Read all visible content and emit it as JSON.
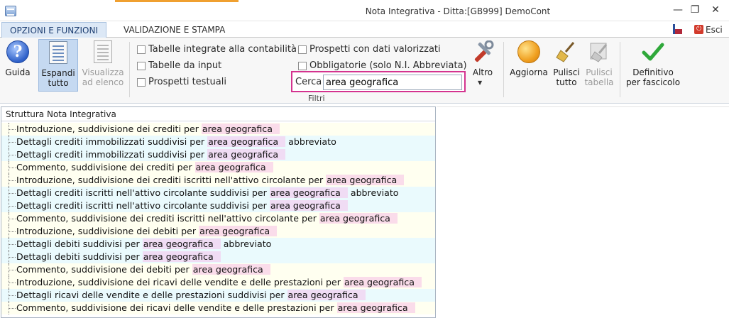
{
  "window": {
    "title": "Nota Integrativa - Ditta:[GB999] DemoCont",
    "minimize": "—",
    "maximize": "❐",
    "close": "✕"
  },
  "tabs": [
    {
      "label": "OPZIONI E FUNZIONI",
      "active": true
    },
    {
      "label": "VALIDAZIONE E STAMPA",
      "active": false
    }
  ],
  "topright": {
    "exit_label": "Esci",
    "exit_icon": "⏻"
  },
  "ribbon": {
    "guida": "Guida",
    "guida_icon": "?",
    "espandi_1": "Espandi",
    "espandi_2": "tutto",
    "visualizza_1": "Visualizza",
    "visualizza_2": "ad elenco",
    "checkboxes": {
      "tabelle_integrate": "Tabelle integrate alla contabilità",
      "tabelle_input": "Tabelle da input",
      "prospetti_testuali": "Prospetti testuali",
      "prospetti_valorizzati": "Prospetti con dati valorizzati",
      "obbligatorie": "Obbligatorie (solo N.I. Abbreviata)"
    },
    "search_label": "Cerca",
    "search_value": "area geografica",
    "filtri": "Filtri",
    "altro": "Altro",
    "aggiorna": "Aggiorna",
    "pulisci_tutto_1": "Pulisci",
    "pulisci_tutto_2": "tutto",
    "pulisci_tabella_1": "Pulisci",
    "pulisci_tabella_2": "tabella",
    "definitivo_1": "Definitivo",
    "definitivo_2": "per fascicolo"
  },
  "tree": {
    "header": "Struttura Nota Integrativa",
    "highlight": "area geografica",
    "rows": [
      {
        "pre": "Introduzione, suddivisione dei crediti per ",
        "post": ""
      },
      {
        "pre": "Dettagli crediti immobilizzati suddivisi per ",
        "post": " abbreviato"
      },
      {
        "pre": "Dettagli crediti immobilizzati suddivisi per ",
        "post": ""
      },
      {
        "pre": "Commento, suddivisione dei crediti per ",
        "post": ""
      },
      {
        "pre": "Introduzione, suddivisione dei crediti iscritti nell'attivo circolante per ",
        "post": ""
      },
      {
        "pre": "Dettagli crediti iscritti nell'attivo circolante suddivisi per ",
        "post": " abbreviato"
      },
      {
        "pre": "Dettagli crediti iscritti nell'attivo circolante suddivisi per ",
        "post": ""
      },
      {
        "pre": "Commento, suddivisione dei crediti iscritti nell'attivo circolante per ",
        "post": ""
      },
      {
        "pre": "Introduzione, suddivisione dei debiti per ",
        "post": ""
      },
      {
        "pre": "Dettagli debiti suddivisi per ",
        "post": " abbreviato"
      },
      {
        "pre": "Dettagli debiti suddivisi per ",
        "post": ""
      },
      {
        "pre": "Commento, suddivisione dei debiti per ",
        "post": ""
      },
      {
        "pre": "Introduzione, suddivisione dei ricavi delle vendite e delle prestazioni per ",
        "post": ""
      },
      {
        "pre": "Dettagli ricavi delle vendite e delle prestazioni suddivisi per ",
        "post": ""
      },
      {
        "pre": "Commento, suddivisione dei ricavi delle vendite e delle prestazioni per ",
        "post": ""
      }
    ]
  },
  "colors": {
    "accent_orange": "#f0a030",
    "tab_active_bg": "#dce8f6",
    "search_border": "#d4338f",
    "highlight_pink": "#fadcea",
    "row_yellow": "#fffff0",
    "row_cyan": "#eafafd"
  }
}
